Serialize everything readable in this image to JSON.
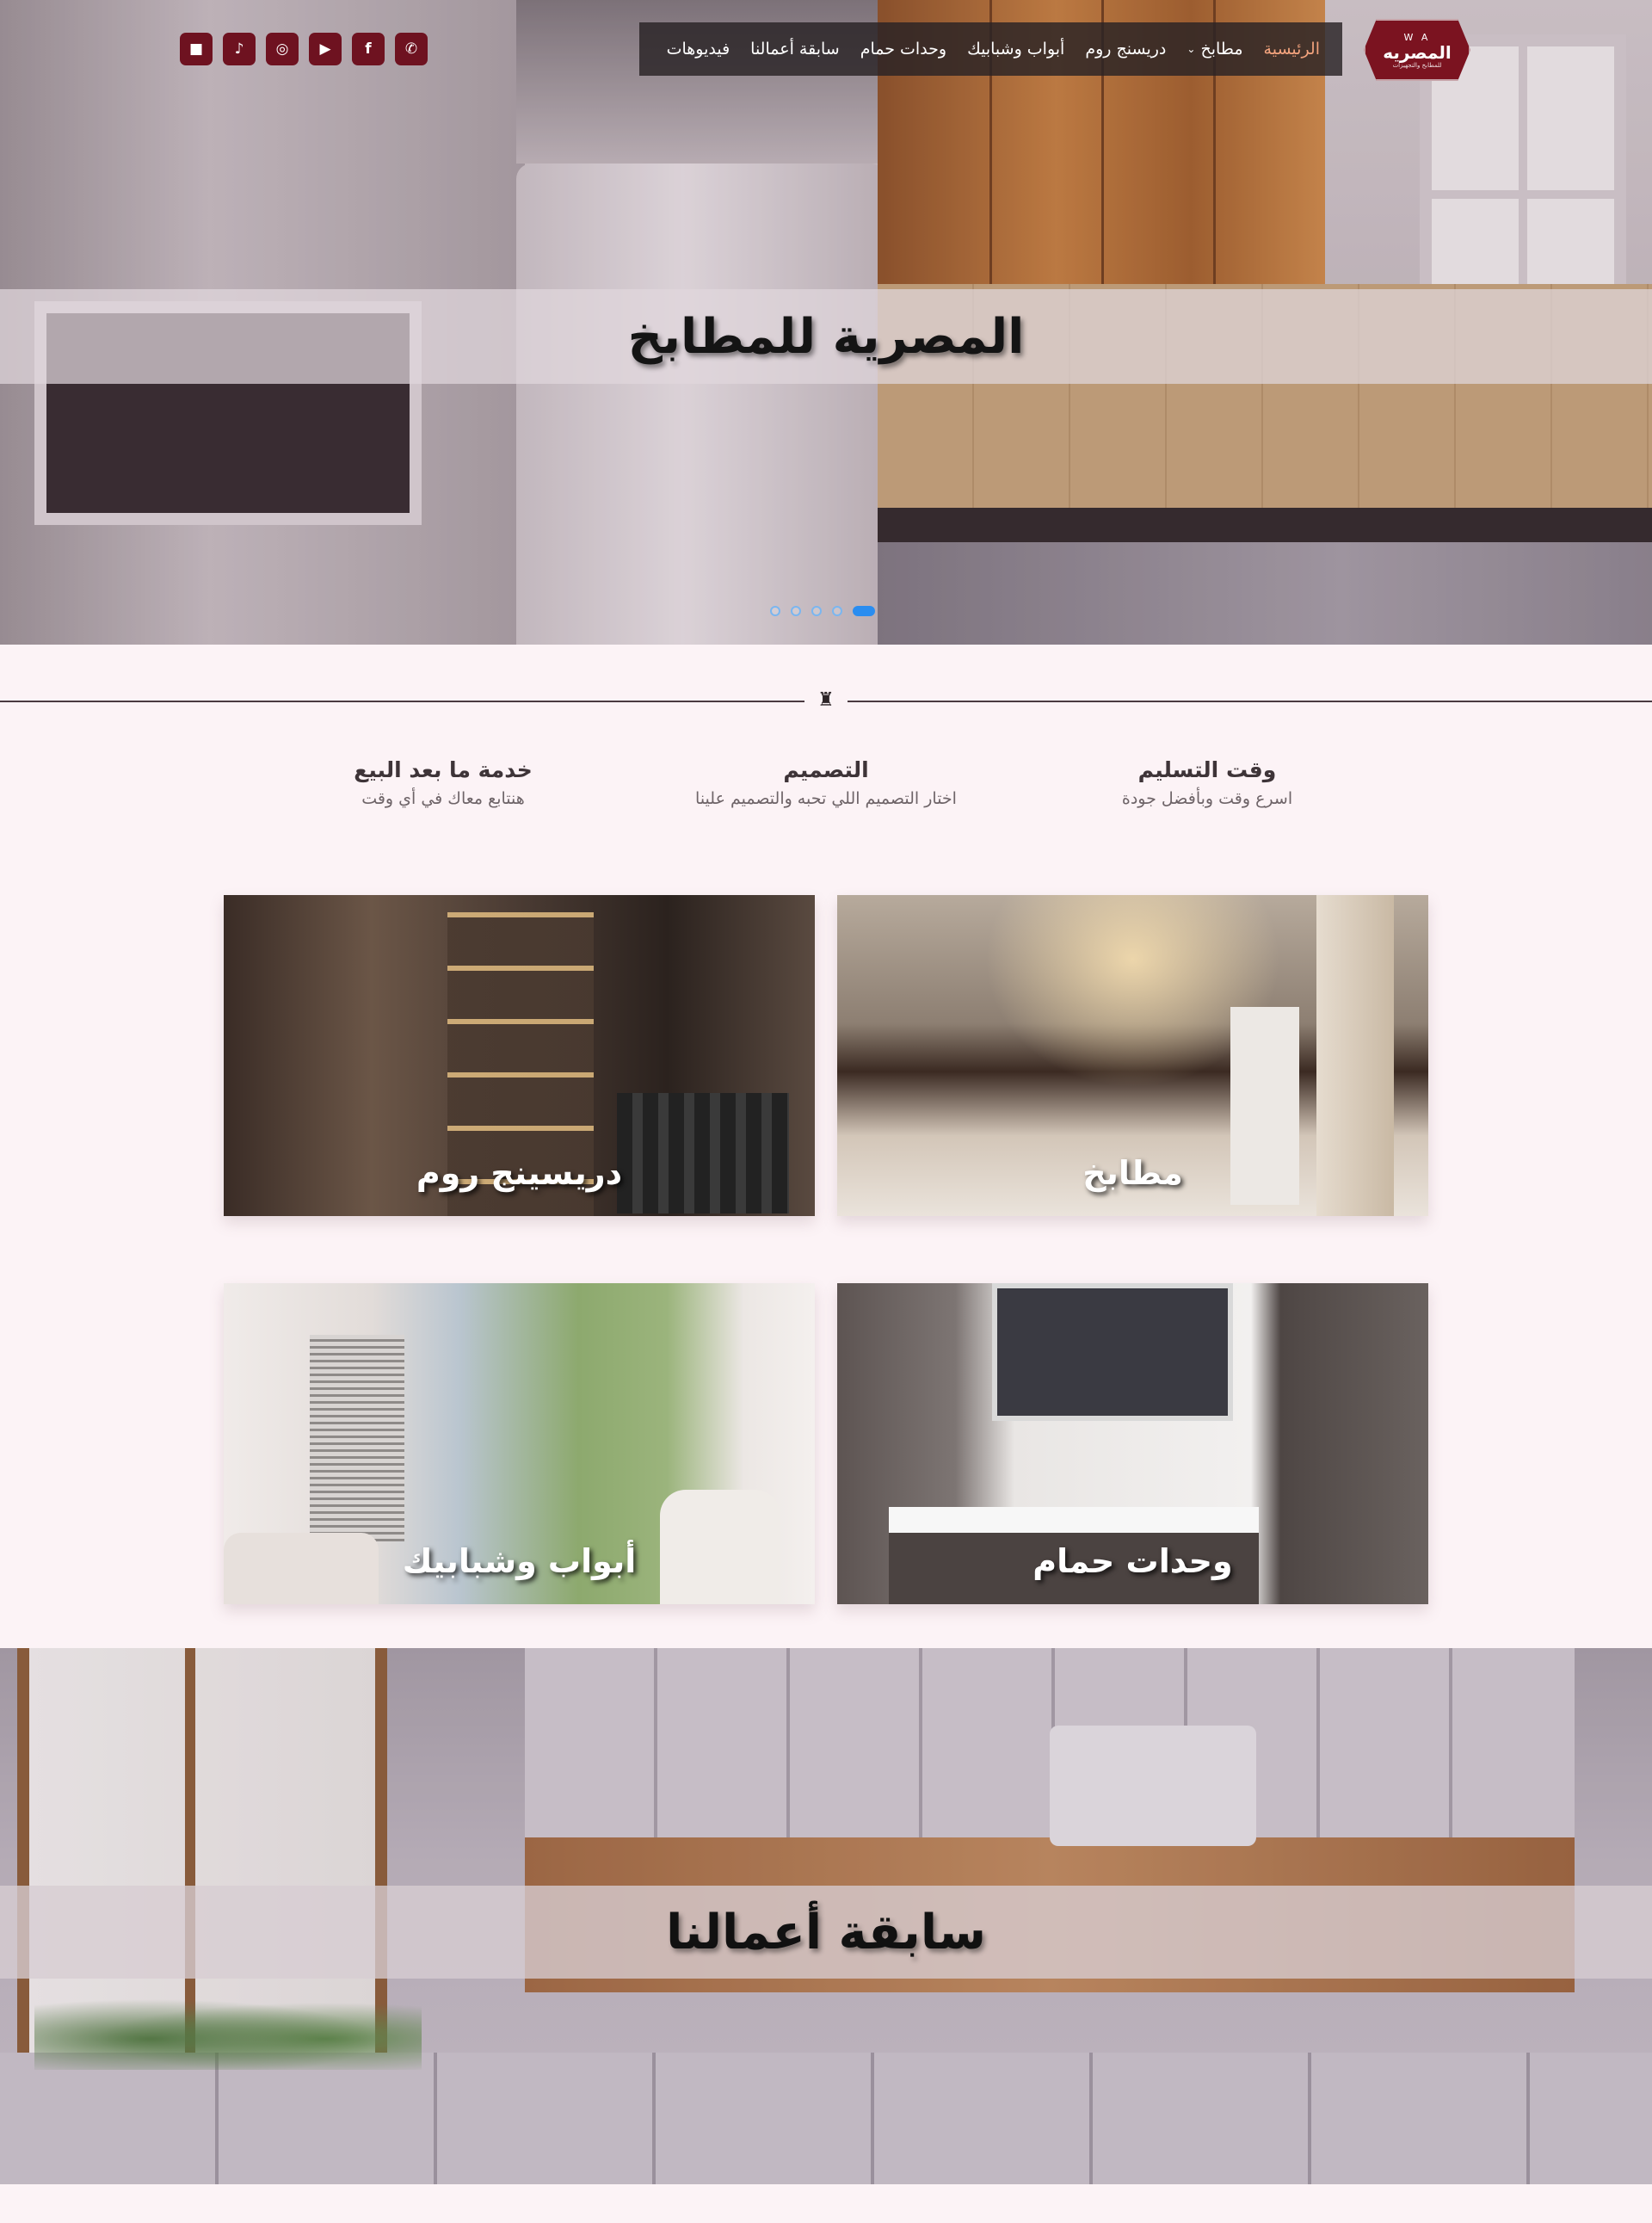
{
  "header": {
    "logo": {
      "mark": "W  A",
      "name": "المصريه",
      "tagline": "للمطابخ والتجهيزات"
    },
    "nav": [
      {
        "label": "الرئيسية",
        "active": true,
        "dropdown": false
      },
      {
        "label": "مطابخ",
        "active": false,
        "dropdown": true
      },
      {
        "label": "دريسنج روم",
        "active": false,
        "dropdown": false
      },
      {
        "label": "أبواب وشبابيك",
        "active": false,
        "dropdown": false
      },
      {
        "label": "وحدات حمام",
        "active": false,
        "dropdown": false
      },
      {
        "label": "سابقة أعمالنا",
        "active": false,
        "dropdown": false
      },
      {
        "label": "فيديوهات",
        "active": false,
        "dropdown": false
      }
    ],
    "social": [
      {
        "icon": "whatsapp-icon",
        "glyph": "✆"
      },
      {
        "icon": "facebook-icon",
        "glyph": "f"
      },
      {
        "icon": "youtube-icon",
        "glyph": "▶"
      },
      {
        "icon": "instagram-icon",
        "glyph": "◎"
      },
      {
        "icon": "tiktok-icon",
        "glyph": "♪"
      },
      {
        "icon": "video-icon",
        "glyph": "■"
      }
    ]
  },
  "hero": {
    "title": "المصرية للمطابخ",
    "slides_count": 5,
    "active_slide": 1
  },
  "features": [
    {
      "title": "وقت التسليم",
      "text": "اسرع وقت وبأفضل جودة"
    },
    {
      "title": "التصميم",
      "text": "اختار التصميم اللي تحبه والتصميم علينا"
    },
    {
      "title": "خدمة ما بعد البيع",
      "text": "هنتابع معاك في أي وقت"
    }
  ],
  "cards": [
    {
      "label": "مطابخ"
    },
    {
      "label": "دريسينج روم"
    },
    {
      "label": "وحدات حمام"
    },
    {
      "label": "أبواب وشبابيك"
    }
  ],
  "portfolio": {
    "title": "سابقة أعمالنا"
  },
  "colors": {
    "brand": "#6e1220",
    "accent": "#f3a37d",
    "slider_active": "#2a8df0",
    "page_bg": "#fcf3f6"
  }
}
